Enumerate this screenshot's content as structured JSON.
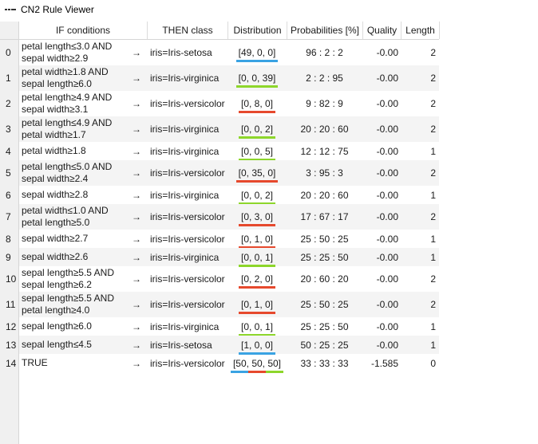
{
  "window": {
    "title": "CN2 Rule Viewer"
  },
  "colors": {
    "setosa": "#3aa3e3",
    "versicolor": "#e6492d",
    "virginica": "#8dd62b"
  },
  "columns": [
    {
      "key": "if",
      "label": "IF conditions"
    },
    {
      "key": "then",
      "label": "THEN class"
    },
    {
      "key": "dist",
      "label": "Distribution"
    },
    {
      "key": "prob",
      "label": "Probabilities [%]"
    },
    {
      "key": "qual",
      "label": "Quality"
    },
    {
      "key": "len",
      "label": "Length"
    }
  ],
  "rows": [
    {
      "idx": "0",
      "if": [
        "petal length≤3.0 AND",
        "sepal width≥2.9"
      ],
      "arrow": "→",
      "then": "iris=Iris-setosa",
      "dist": "[49, 0, 0]",
      "dist_values": [
        49,
        0,
        0
      ],
      "prob": "96 : 2 : 2",
      "qual": "-0.00",
      "len": "2"
    },
    {
      "idx": "1",
      "if": [
        "petal width≥1.8 AND",
        "sepal length≥6.0"
      ],
      "arrow": "→",
      "then": "iris=Iris-virginica",
      "dist": "[0, 0, 39]",
      "dist_values": [
        0,
        0,
        39
      ],
      "prob": "2 : 2 : 95",
      "qual": "-0.00",
      "len": "2"
    },
    {
      "idx": "2",
      "if": [
        "petal length≥4.9 AND",
        "sepal width≥3.1"
      ],
      "arrow": "→",
      "then": "iris=Iris-versicolor",
      "dist": "[0, 8, 0]",
      "dist_values": [
        0,
        8,
        0
      ],
      "prob": "9 : 82 : 9",
      "qual": "-0.00",
      "len": "2"
    },
    {
      "idx": "3",
      "if": [
        "petal length≤4.9 AND",
        "petal width≥1.7"
      ],
      "arrow": "→",
      "then": "iris=Iris-virginica",
      "dist": "[0, 0, 2]",
      "dist_values": [
        0,
        0,
        2
      ],
      "prob": "20 : 20 : 60",
      "qual": "-0.00",
      "len": "2"
    },
    {
      "idx": "4",
      "if": [
        "petal width≥1.8"
      ],
      "arrow": "→",
      "then": "iris=Iris-virginica",
      "dist": "[0, 0, 5]",
      "dist_values": [
        0,
        0,
        5
      ],
      "prob": "12 : 12 : 75",
      "qual": "-0.00",
      "len": "1"
    },
    {
      "idx": "5",
      "if": [
        "petal length≤5.0 AND",
        "sepal width≥2.4"
      ],
      "arrow": "→",
      "then": "iris=Iris-versicolor",
      "dist": "[0, 35, 0]",
      "dist_values": [
        0,
        35,
        0
      ],
      "prob": "3 : 95 : 3",
      "qual": "-0.00",
      "len": "2"
    },
    {
      "idx": "6",
      "if": [
        "sepal width≥2.8"
      ],
      "arrow": "→",
      "then": "iris=Iris-virginica",
      "dist": "[0, 0, 2]",
      "dist_values": [
        0,
        0,
        2
      ],
      "prob": "20 : 20 : 60",
      "qual": "-0.00",
      "len": "1"
    },
    {
      "idx": "7",
      "if": [
        "petal width≤1.0 AND",
        "petal length≥5.0"
      ],
      "arrow": "→",
      "then": "iris=Iris-versicolor",
      "dist": "[0, 3, 0]",
      "dist_values": [
        0,
        3,
        0
      ],
      "prob": "17 : 67 : 17",
      "qual": "-0.00",
      "len": "2"
    },
    {
      "idx": "8",
      "if": [
        "sepal width≥2.7"
      ],
      "arrow": "→",
      "then": "iris=Iris-versicolor",
      "dist": "[0, 1, 0]",
      "dist_values": [
        0,
        1,
        0
      ],
      "prob": "25 : 50 : 25",
      "qual": "-0.00",
      "len": "1"
    },
    {
      "idx": "9",
      "if": [
        "sepal width≥2.6"
      ],
      "arrow": "→",
      "then": "iris=Iris-virginica",
      "dist": "[0, 0, 1]",
      "dist_values": [
        0,
        0,
        1
      ],
      "prob": "25 : 25 : 50",
      "qual": "-0.00",
      "len": "1"
    },
    {
      "idx": "10",
      "if": [
        "sepal length≥5.5 AND",
        "sepal length≥6.2"
      ],
      "arrow": "→",
      "then": "iris=Iris-versicolor",
      "dist": "[0, 2, 0]",
      "dist_values": [
        0,
        2,
        0
      ],
      "prob": "20 : 60 : 20",
      "qual": "-0.00",
      "len": "2"
    },
    {
      "idx": "11",
      "if": [
        "sepal length≥5.5 AND",
        "petal length≥4.0"
      ],
      "arrow": "→",
      "then": "iris=Iris-versicolor",
      "dist": "[0, 1, 0]",
      "dist_values": [
        0,
        1,
        0
      ],
      "prob": "25 : 50 : 25",
      "qual": "-0.00",
      "len": "2"
    },
    {
      "idx": "12",
      "if": [
        "sepal length≥6.0"
      ],
      "arrow": "→",
      "then": "iris=Iris-virginica",
      "dist": "[0, 0, 1]",
      "dist_values": [
        0,
        0,
        1
      ],
      "prob": "25 : 25 : 50",
      "qual": "-0.00",
      "len": "1"
    },
    {
      "idx": "13",
      "if": [
        "sepal length≤4.5"
      ],
      "arrow": "→",
      "then": "iris=Iris-setosa",
      "dist": "[1, 0, 0]",
      "dist_values": [
        1,
        0,
        0
      ],
      "prob": "50 : 25 : 25",
      "qual": "-0.00",
      "len": "1"
    },
    {
      "idx": "14",
      "if": [
        "TRUE"
      ],
      "arrow": "→",
      "then": "iris=Iris-versicolor",
      "dist": "[50, 50, 50]",
      "dist_values": [
        50,
        50,
        50
      ],
      "prob": "33 : 33 : 33",
      "qual": "-1.585",
      "len": "0"
    }
  ]
}
